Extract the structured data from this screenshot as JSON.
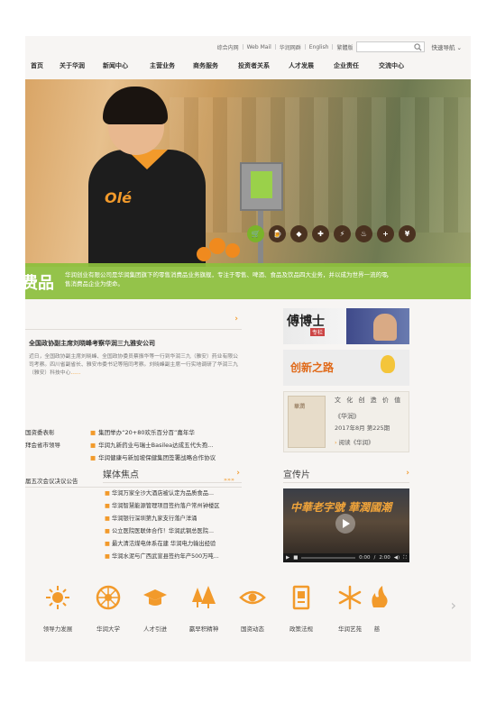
{
  "utility": {
    "links": [
      "综合内网",
      "Web Mail",
      "华润网群",
      "English",
      "繁體版"
    ],
    "search_placeholder": "",
    "quick_nav": "快速导航"
  },
  "nav": {
    "items": [
      "首页",
      "关于华润",
      "新闻中心",
      "主营业务",
      "商务服务",
      "投资者关系",
      "人才发展",
      "企业责任",
      "交流中心"
    ]
  },
  "hero": {
    "brand_on_apron": "Olé",
    "business_icons": [
      "retail",
      "beer",
      "food",
      "pharma",
      "power",
      "gas",
      "medical",
      "finance"
    ]
  },
  "band": {
    "big_text": "费品",
    "text": "华润创业有限公司是华润集团旗下的零售消费品业务旗舰，专注于零售、啤酒、食品及饮品四大业务，并以成为世界一流的零售消费品企业为使命。"
  },
  "news": {
    "headline": "全国政协副主席刘晓峰考察华润三九雅安公司",
    "summary": "近日，全国政协副主席刘晓峰、全国政协委员蔡振华等一行到华润三九（雅安）药业有限公司考察。四川省副省长、雅安市委书记等陪同考察。刘晓峰副主席一行实地调研了华润三九（雅安）科技中心",
    "summary_more": "......",
    "left_rows": [
      "国资委表彰",
      "拜会省市领导"
    ],
    "right_rows": [
      "集团举办“20+80欢乐百分百”嘉年华",
      "华润九新药业与瑞士Basilea达成五代头孢...",
      "华润健康与新加坡保健集团签署战略合作协议"
    ],
    "last_row": "届五次会议决议公告",
    "more_label": "»»»"
  },
  "promos": {
    "p1_title": "傅博士",
    "p1_badge": "专栏",
    "p2_title": "创新之路",
    "p3_cover": "華潤",
    "p3_line1": "文 化 创 造 价 值",
    "p3_line2": "《华润》",
    "p3_line3": "2017年8月 第225期",
    "p3_line4": "阅读《华润》"
  },
  "media": {
    "title": "媒体焦点",
    "items": [
      "华润万家全沙大酒店被认定为品质食品...",
      "华润智慧能源管理项目签约落户常州钟楼区",
      "华润银行深圳第九家支行落户洋涌",
      "公立医院医联体合作！华润武钢总医院...",
      "最大清洁煤电体系在建 华润电力输出经验",
      "华润水泥与广西武宣县签约年产500万吨..."
    ]
  },
  "video": {
    "title": "宣传片",
    "caption": "中華老字號 華潤國潮",
    "time_current": "0:00",
    "time_total": "2:00",
    "progress": 0.0
  },
  "bottom_icons": [
    {
      "label": "领导力发展",
      "icon": "sun-icon"
    },
    {
      "label": "华润大学",
      "icon": "wheel-icon"
    },
    {
      "label": "人才引进",
      "icon": "graduation-cap-icon"
    },
    {
      "label": "赢早积精神",
      "icon": "trees-icon"
    },
    {
      "label": "国资动态",
      "icon": "eye-icon"
    },
    {
      "label": "政策法规",
      "icon": "book-icon"
    },
    {
      "label": "华润艺苑",
      "icon": "snowflake-icon"
    },
    {
      "label": "慈",
      "icon": "flame-icon"
    }
  ],
  "colors": {
    "accent_orange": "#f29a2b",
    "band_green": "#8cbe3c",
    "text_dark": "#333333"
  }
}
